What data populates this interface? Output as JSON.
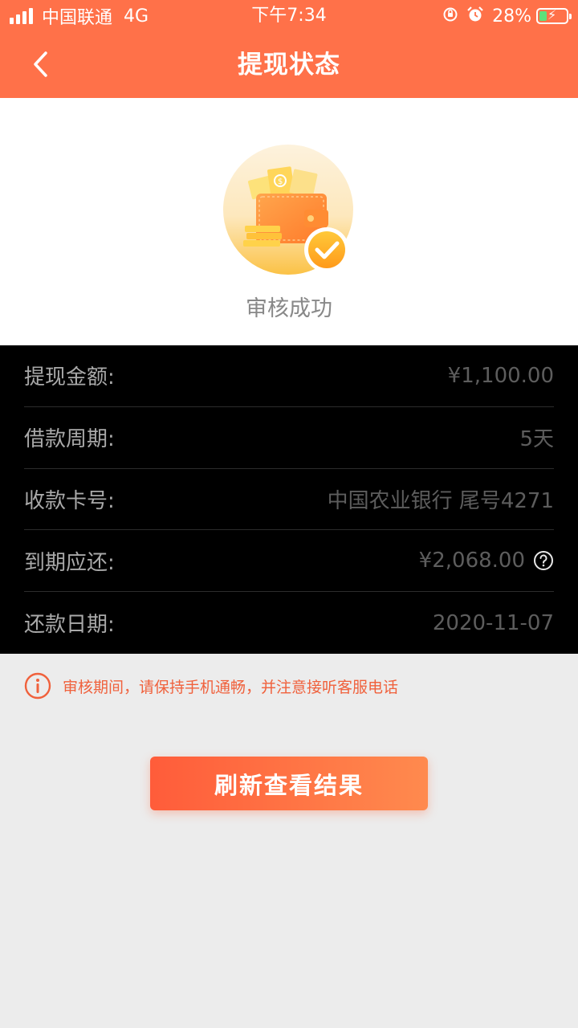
{
  "status_bar": {
    "carrier": "中国联通",
    "network": "4G",
    "time": "下午7:34",
    "battery": "28%",
    "icons": [
      "signal-icon",
      "rotation-lock-icon",
      "alarm-icon",
      "battery-charging-icon"
    ]
  },
  "header": {
    "title": "提现状态",
    "back_icon": "chevron-left-icon",
    "background": "#ff7149"
  },
  "hero": {
    "icon": "wallet-success-icon",
    "status_text": "审核成功"
  },
  "details": [
    {
      "label": "提现金额:",
      "value": "¥1,100.00"
    },
    {
      "label": "借款周期:",
      "value": "5天"
    },
    {
      "label": "收款卡号:",
      "value": "中国农业银行 尾号4271"
    },
    {
      "label": "到期应还:",
      "value": "¥2,068.00",
      "help_icon": "question-circle-icon"
    },
    {
      "label": "还款日期:",
      "value": "2020-11-07"
    }
  ],
  "notice": {
    "icon": "info-circle-icon",
    "text": "审核期间，请保持手机通畅，并注意接听客服电话",
    "color": "#f0613c"
  },
  "refresh_button": {
    "label": "刷新查看结果",
    "gradient": [
      "#ff5c3a",
      "#ff8a4e"
    ]
  }
}
